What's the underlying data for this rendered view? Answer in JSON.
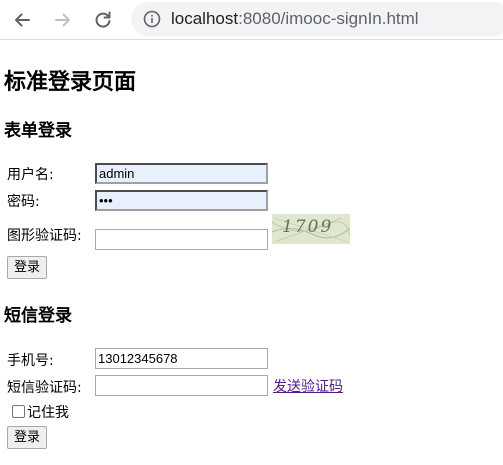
{
  "browser": {
    "url_host": "localhost",
    "url_rest": ":8080/imooc-signIn.html"
  },
  "page": {
    "title": "标准登录页面"
  },
  "form_login": {
    "heading": "表单登录",
    "username_label": "用户名:",
    "username_value": "admin",
    "password_label": "密码:",
    "password_value": "•••",
    "captcha_label": "图形验证码:",
    "captcha_value": "",
    "captcha_image_text": "1709",
    "submit_label": "登录"
  },
  "sms_login": {
    "heading": "短信登录",
    "phone_label": "手机号:",
    "phone_value": "13012345678",
    "sms_code_label": "短信验证码:",
    "sms_code_value": "",
    "send_code_link": "发送验证码",
    "remember_me_label": "记住我",
    "remember_me_checked": false,
    "submit_label": "登录"
  },
  "icons": {
    "back": "back-arrow-icon",
    "forward": "forward-arrow-icon",
    "reload": "reload-icon",
    "info": "info-icon"
  }
}
